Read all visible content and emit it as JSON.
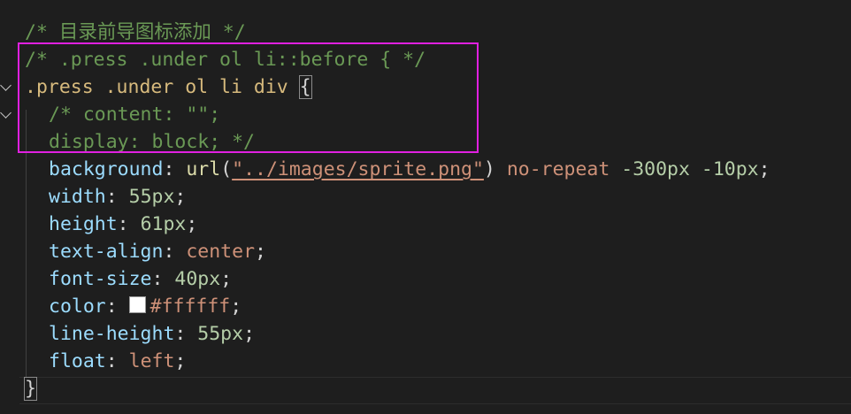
{
  "lines": {
    "l1": {
      "comment": "/* 目录前导图标添加 */"
    },
    "l2": {
      "comment": "/* .press .under ol li::before { */"
    },
    "l3": {
      "selector": ".press .under ol li div",
      "brace": "{"
    },
    "l4": {
      "comment": "/* content: \"\";"
    },
    "l5": {
      "comment": "display: block; */"
    },
    "l6": {
      "prop": "background",
      "colon": ": ",
      "fn": "url",
      "paren_open": "(",
      "str": "\"../images/sprite.png\"",
      "paren_close": ")",
      "kw": " no-repeat ",
      "num": "-300px -10px",
      "semi": ";"
    },
    "l7": {
      "prop": "width",
      "colon": ": ",
      "num": "55px",
      "semi": ";"
    },
    "l8": {
      "prop": "height",
      "colon": ": ",
      "num": "61px",
      "semi": ";"
    },
    "l9": {
      "prop": "text-align",
      "colon": ": ",
      "kw": "center",
      "semi": ";"
    },
    "l10": {
      "prop": "font-size",
      "colon": ": ",
      "num": "40px",
      "semi": ";"
    },
    "l11": {
      "prop": "color",
      "colon": ": ",
      "kw": "#ffffff",
      "semi": ";",
      "swatch_color": "#ffffff"
    },
    "l12": {
      "prop": "line-height",
      "colon": ": ",
      "num": "55px",
      "semi": ";"
    },
    "l13": {
      "prop": "float",
      "colon": ": ",
      "kw": "left",
      "semi": ";"
    },
    "l14": {
      "brace": "}"
    }
  },
  "gutter": {
    "fold_icons": [
      "chevron-down-icon",
      "chevron-down-icon"
    ]
  },
  "colors": {
    "background": "#1e1e1e",
    "comment": "#6a9955",
    "selector": "#d7ba7d",
    "property": "#9cdcfe",
    "number": "#b5cea8",
    "keyword": "#ce9178",
    "function": "#dcdcaa",
    "annotation_box": "#e020e0"
  }
}
